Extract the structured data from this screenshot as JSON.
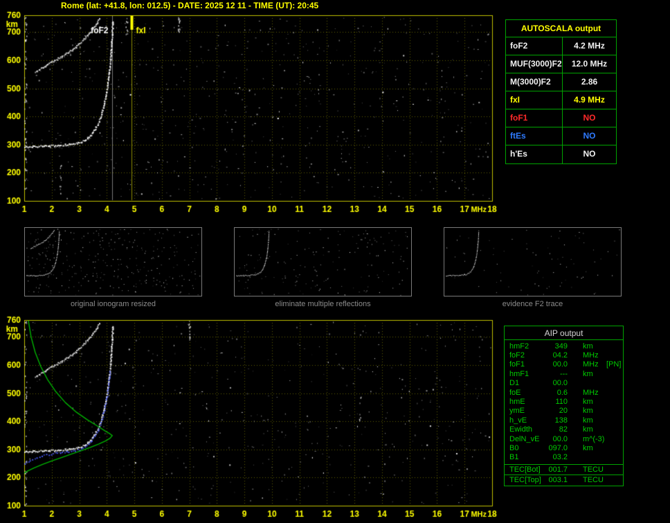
{
  "header": {
    "title": "Rome (lat: +41.8, lon: 012.5) - DATE: 2025 12 11 - TIME (UT): 20:45"
  },
  "autoscala": {
    "title": "AUTOSCALA output",
    "rows": [
      {
        "label": "foF2",
        "value": "4.2 MHz",
        "color": "#f0f0f0"
      },
      {
        "label": "MUF(3000)F2",
        "value": "12.0 MHz",
        "color": "#f0f0f0"
      },
      {
        "label": "M(3000)F2",
        "value": "2.86",
        "color": "#f0f0f0"
      },
      {
        "label": "fxI",
        "value": "4.9 MHz",
        "color": "#ffff00"
      },
      {
        "label": "foF1",
        "value": "NO",
        "color": "#ff2a2a"
      },
      {
        "label": "ftEs",
        "value": "NO",
        "color": "#2f7bff"
      },
      {
        "label": "h'Es",
        "value": "NO",
        "color": "#f0f0f0"
      }
    ]
  },
  "thumbnails": {
    "items": [
      {
        "caption": "original ionogram resized",
        "series_refs": [
          0,
          1
        ],
        "noise_dots": 300,
        "seed": 3
      },
      {
        "caption": "eliminate multiple reflections",
        "series_refs": [
          0
        ],
        "noise_dots": 170,
        "seed": 4
      },
      {
        "caption": "evidence F2 trace",
        "series_refs": [
          0
        ],
        "noise_dots": 80,
        "seed": 5
      }
    ]
  },
  "aip": {
    "title": "AIP output",
    "rows": [
      {
        "param": "hmF2",
        "value": "349",
        "unit": "km",
        "note": ""
      },
      {
        "param": "foF2",
        "value": "04.2",
        "unit": "MHz",
        "note": ""
      },
      {
        "param": "foF1",
        "value": "00.0",
        "unit": "MHz",
        "note": "[PN]"
      },
      {
        "param": "hmF1",
        "value": "---",
        "unit": "km",
        "note": ""
      },
      {
        "param": "D1",
        "value": "00.0",
        "unit": "",
        "note": ""
      },
      {
        "param": "foE",
        "value": "0.6",
        "unit": "MHz",
        "note": ""
      },
      {
        "param": "hmE",
        "value": "110",
        "unit": "km",
        "note": ""
      },
      {
        "param": "ymE",
        "value": "20",
        "unit": "km",
        "note": ""
      },
      {
        "param": "h_vE",
        "value": "138",
        "unit": "km",
        "note": ""
      },
      {
        "param": "Ewidth",
        "value": "82",
        "unit": "km",
        "note": ""
      },
      {
        "param": "DelN_vE",
        "value": "00.0",
        "unit": "m^(-3)",
        "note": ""
      },
      {
        "param": "B0",
        "value": "097.0",
        "unit": "km",
        "note": ""
      },
      {
        "param": "B1",
        "value": "03.2",
        "unit": "",
        "note": ""
      },
      {
        "param": "TEC[Bot]",
        "value": "001.7",
        "unit": "TECU",
        "note": "",
        "sep": true
      },
      {
        "param": "TEC[Top]",
        "value": "003.1",
        "unit": "TECU",
        "note": ""
      }
    ]
  },
  "chart_data": [
    {
      "id": "top-ionogram",
      "type": "scatter",
      "title": "recorded ionogram with AUTOSCALA frequency markers",
      "xlabel": "MHz",
      "ylabel": "km",
      "xlim": [
        1,
        18
      ],
      "ylim": [
        100,
        760
      ],
      "xticks": [
        1,
        2,
        3,
        4,
        5,
        6,
        7,
        8,
        9,
        10,
        11,
        12,
        13,
        14,
        15,
        16,
        17,
        18
      ],
      "yticks": [
        760,
        700,
        600,
        500,
        400,
        300,
        200,
        100
      ],
      "grid": true,
      "frame_color": "#c0c000",
      "grid_color": "#606000",
      "tick_color": "#ffff00",
      "vlines": [
        {
          "x": 4.2,
          "color": "#e0e0e0",
          "label": "foF2",
          "label_color": "#ffffff",
          "label_side": "left",
          "top_mark": 0
        },
        {
          "x": 4.9,
          "color": "#ffff00",
          "label": "fxI",
          "label_color": "#ffff00",
          "label_side": "right",
          "top_mark": 20
        }
      ],
      "series": [
        {
          "name": "F2-trace-1st-hop",
          "color": "#ffffff",
          "style": "trace",
          "seed": 11,
          "points": [
            [
              1.0,
              293
            ],
            [
              1.4,
              295
            ],
            [
              1.8,
              297
            ],
            [
              2.2,
              299
            ],
            [
              2.6,
              302
            ],
            [
              3.0,
              308
            ],
            [
              3.2,
              318
            ],
            [
              3.4,
              334
            ],
            [
              3.55,
              355
            ],
            [
              3.7,
              382
            ],
            [
              3.82,
              418
            ],
            [
              3.92,
              458
            ],
            [
              4.0,
              500
            ],
            [
              4.06,
              545
            ],
            [
              4.11,
              592
            ],
            [
              4.15,
              640
            ],
            [
              4.18,
              692
            ],
            [
              4.2,
              745
            ]
          ]
        },
        {
          "name": "F2-trace-2nd-hop",
          "color": "#e0e0e0",
          "style": "trace",
          "seed": 23,
          "points": [
            [
              1.4,
              560
            ],
            [
              1.7,
              580
            ],
            [
              2.0,
              596
            ],
            [
              2.3,
              612
            ],
            [
              2.6,
              630
            ],
            [
              2.9,
              652
            ],
            [
              3.15,
              676
            ],
            [
              3.4,
              702
            ],
            [
              3.6,
              728
            ],
            [
              3.75,
              755
            ]
          ]
        }
      ],
      "noise": {
        "seed": 42,
        "dots": 640,
        "columns": [
          {
            "x": 1.04,
            "count": 60,
            "h0": 100,
            "h1": 760
          },
          {
            "x": 6.62,
            "count": 16,
            "h0": 700,
            "h1": 760
          },
          {
            "x": 4.72,
            "count": 10,
            "h0": 690,
            "h1": 760
          },
          {
            "x": 2.3,
            "count": 10,
            "h0": 120,
            "h1": 240
          }
        ]
      }
    },
    {
      "id": "bottom-ionogram",
      "type": "scatter",
      "title": "ionogram with restored trace and electron density profile",
      "xlabel": "MHz",
      "ylabel": "km",
      "xlim": [
        1,
        18
      ],
      "ylim": [
        100,
        760
      ],
      "xticks": [
        1,
        2,
        3,
        4,
        5,
        6,
        7,
        8,
        9,
        10,
        11,
        12,
        13,
        14,
        15,
        16,
        17,
        18
      ],
      "yticks": [
        760,
        700,
        600,
        500,
        400,
        300,
        200,
        100
      ],
      "grid": true,
      "frame_color": "#c0c000",
      "grid_color": "#606000",
      "tick_color": "#ffff00",
      "vlines": [],
      "series": [
        {
          "name": "F2-trace-1st-hop",
          "color": "#ffffff",
          "style": "trace",
          "seed": 11,
          "points": [
            [
              1.0,
              293
            ],
            [
              1.4,
              295
            ],
            [
              1.8,
              297
            ],
            [
              2.2,
              299
            ],
            [
              2.6,
              302
            ],
            [
              3.0,
              308
            ],
            [
              3.2,
              318
            ],
            [
              3.4,
              334
            ],
            [
              3.55,
              355
            ],
            [
              3.7,
              382
            ],
            [
              3.82,
              418
            ],
            [
              3.92,
              458
            ],
            [
              4.0,
              500
            ],
            [
              4.06,
              545
            ],
            [
              4.11,
              592
            ],
            [
              4.15,
              640
            ],
            [
              4.18,
              692
            ],
            [
              4.2,
              745
            ]
          ]
        },
        {
          "name": "F2-trace-2nd-hop",
          "color": "#e0e0e0",
          "style": "trace",
          "seed": 23,
          "points": [
            [
              1.4,
              560
            ],
            [
              1.7,
              580
            ],
            [
              2.0,
              596
            ],
            [
              2.3,
              612
            ],
            [
              2.6,
              630
            ],
            [
              2.9,
              652
            ],
            [
              3.15,
              676
            ],
            [
              3.4,
              702
            ],
            [
              3.6,
              728
            ],
            [
              3.75,
              755
            ]
          ]
        },
        {
          "name": "restored-trace",
          "color": "#4a5cff",
          "style": "dots",
          "seed": 31,
          "points": [
            [
              1.0,
              252
            ],
            [
              1.2,
              263
            ],
            [
              1.45,
              274
            ],
            [
              1.8,
              283
            ],
            [
              2.2,
              289
            ],
            [
              2.6,
              294
            ],
            [
              3.0,
              301
            ],
            [
              3.2,
              311
            ],
            [
              3.4,
              327
            ],
            [
              3.55,
              348
            ],
            [
              3.7,
              375
            ],
            [
              3.82,
              411
            ],
            [
              3.92,
              451
            ],
            [
              4.0,
              493
            ],
            [
              4.06,
              538
            ],
            [
              4.11,
              585
            ]
          ]
        },
        {
          "name": "electron-density-profile",
          "color": "#00b400",
          "style": "line",
          "points": [
            [
              1.15,
              758
            ],
            [
              1.25,
              700
            ],
            [
              1.4,
              645
            ],
            [
              1.6,
              595
            ],
            [
              1.85,
              548
            ],
            [
              2.15,
              505
            ],
            [
              2.5,
              466
            ],
            [
              2.9,
              432
            ],
            [
              3.3,
              405
            ],
            [
              3.68,
              382
            ],
            [
              3.95,
              365
            ],
            [
              4.12,
              355
            ],
            [
              4.2,
              349
            ],
            [
              4.12,
              340
            ],
            [
              3.95,
              330
            ],
            [
              3.7,
              319
            ],
            [
              3.4,
              307
            ],
            [
              3.05,
              295
            ],
            [
              2.7,
              283
            ],
            [
              2.35,
              271
            ],
            [
              2.0,
              259
            ],
            [
              1.65,
              246
            ],
            [
              1.35,
              234
            ],
            [
              1.1,
              222
            ],
            [
              1.0,
              216
            ]
          ]
        }
      ],
      "noise": {
        "seed": 97,
        "dots": 520,
        "columns": [
          {
            "x": 1.04,
            "count": 50,
            "h0": 100,
            "h1": 760
          },
          {
            "x": 7.0,
            "count": 12,
            "h0": 680,
            "h1": 760
          },
          {
            "x": 13.2,
            "count": 8,
            "h0": 380,
            "h1": 520
          }
        ]
      }
    }
  ]
}
